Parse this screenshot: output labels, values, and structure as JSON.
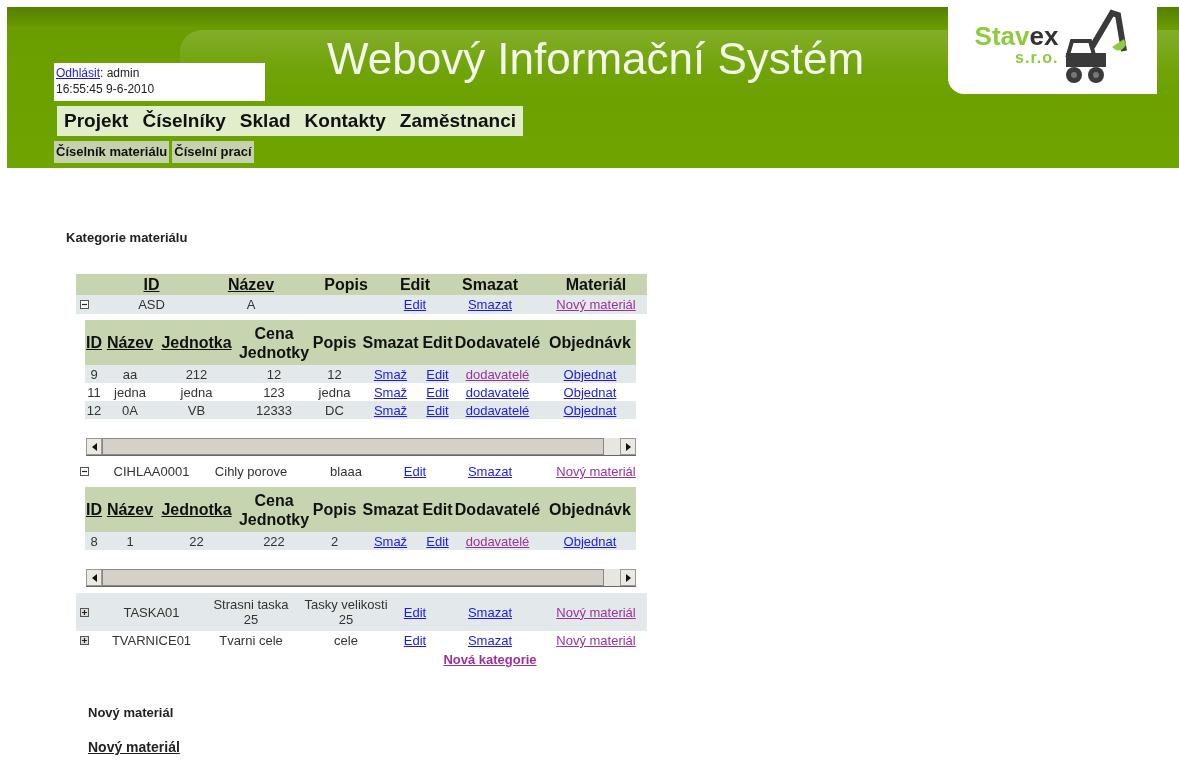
{
  "header": {
    "title": "Webový Informační Systém",
    "logo": {
      "name_start": "Stav",
      "name_end": "ex",
      "suffix": "s.r.o."
    },
    "user": {
      "logout_link": "Odhlásit",
      "user_text": ": admin",
      "datetime": "16:55:45 9-6-2010"
    },
    "menu": [
      "Projekt",
      "Číselníky",
      "Sklad",
      "Kontakty",
      "Zaměstnanci"
    ],
    "submenu": [
      "Číselník materiálu",
      "Číselní prací"
    ]
  },
  "section_title": "Kategorie materiálu",
  "category_table": {
    "columns": [
      {
        "label": "ID",
        "sortable": true
      },
      {
        "label": "Název",
        "sortable": true
      },
      {
        "label": "Popis",
        "sortable": false
      },
      {
        "label": "Edit",
        "sortable": false
      },
      {
        "label": "Smazat",
        "sortable": false
      },
      {
        "label": "Materiál",
        "sortable": false
      }
    ],
    "rows": [
      {
        "id": "ASD",
        "name": "A",
        "description": "",
        "expanded": true,
        "actions": [
          {
            "label": "Edit",
            "visited": false
          },
          {
            "label": "Smazat",
            "visited": false
          },
          {
            "label": "Nový materiál",
            "visited": true
          }
        ],
        "materials": {
          "columns": [
            {
              "label": "ID",
              "sortable": true
            },
            {
              "label": "Název",
              "sortable": true
            },
            {
              "label": "Jednotka",
              "sortable": true
            },
            {
              "label": "Cena Jednotky",
              "sortable": false
            },
            {
              "label": "Popis",
              "sortable": false
            },
            {
              "label": "Smazat",
              "sortable": false
            },
            {
              "label": "Edit",
              "sortable": false
            },
            {
              "label": "Dodavatelé",
              "sortable": false
            },
            {
              "label": "Objednávk",
              "sortable": false
            }
          ],
          "rows": [
            {
              "cells": [
                "9",
                "aa",
                "212",
                "12",
                "12"
              ],
              "links": [
                {
                  "label": "Smaž",
                  "visited": false
                },
                {
                  "label": "Edit",
                  "visited": false
                },
                {
                  "label": "dodavatelé",
                  "visited": true
                },
                {
                  "label": "Objednat",
                  "visited": false
                }
              ]
            },
            {
              "cells": [
                "11",
                "jedna",
                "jedna",
                "123",
                "jedna"
              ],
              "links": [
                {
                  "label": "Smaž",
                  "visited": false
                },
                {
                  "label": "Edit",
                  "visited": false
                },
                {
                  "label": "dodavatelé",
                  "visited": false
                },
                {
                  "label": "Objednat",
                  "visited": false
                }
              ]
            },
            {
              "cells": [
                "12",
                "0A",
                "VB",
                "12333",
                "DC"
              ],
              "links": [
                {
                  "label": "Smaž",
                  "visited": false
                },
                {
                  "label": "Edit",
                  "visited": false
                },
                {
                  "label": "dodavatelé",
                  "visited": false
                },
                {
                  "label": "Objednat",
                  "visited": false
                }
              ]
            }
          ]
        }
      },
      {
        "id": "CIHLAA0001",
        "name": "Cihly porove",
        "description": "blaaa",
        "expanded": true,
        "actions": [
          {
            "label": "Edit",
            "visited": false
          },
          {
            "label": "Smazat",
            "visited": false
          },
          {
            "label": "Nový materiál",
            "visited": true
          }
        ],
        "materials": {
          "columns": [
            {
              "label": "ID",
              "sortable": true
            },
            {
              "label": "Název",
              "sortable": true
            },
            {
              "label": "Jednotka",
              "sortable": true
            },
            {
              "label": "Cena Jednotky",
              "sortable": false
            },
            {
              "label": "Popis",
              "sortable": false
            },
            {
              "label": "Smazat",
              "sortable": false
            },
            {
              "label": "Edit",
              "sortable": false
            },
            {
              "label": "Dodavatelé",
              "sortable": false
            },
            {
              "label": "Objednávk",
              "sortable": false
            }
          ],
          "rows": [
            {
              "cells": [
                "8",
                "1",
                "22",
                "222",
                "2"
              ],
              "links": [
                {
                  "label": "Smaž",
                  "visited": false
                },
                {
                  "label": "Edit",
                  "visited": false
                },
                {
                  "label": "dodavatelé",
                  "visited": true
                },
                {
                  "label": "Objednat",
                  "visited": false
                }
              ]
            }
          ]
        }
      },
      {
        "id": "TASKA01",
        "name": "Strasni taska 25",
        "description": "Tasky velikosti 25",
        "expanded": false,
        "actions": [
          {
            "label": "Edit",
            "visited": false
          },
          {
            "label": "Smazat",
            "visited": false
          },
          {
            "label": "Nový materiál",
            "visited": true
          }
        ]
      },
      {
        "id": "TVARNICE01",
        "name": "Tvarni cele",
        "description": "cele",
        "expanded": false,
        "actions": [
          {
            "label": "Edit",
            "visited": false
          },
          {
            "label": "Smazat",
            "visited": false
          },
          {
            "label": "Nový materiál",
            "visited": true
          }
        ]
      }
    ],
    "new_category": {
      "label": "Nová kategorie",
      "visited": true
    }
  },
  "new_material_heading": "Nový materiál",
  "new_material_link": "Nový materiál"
}
